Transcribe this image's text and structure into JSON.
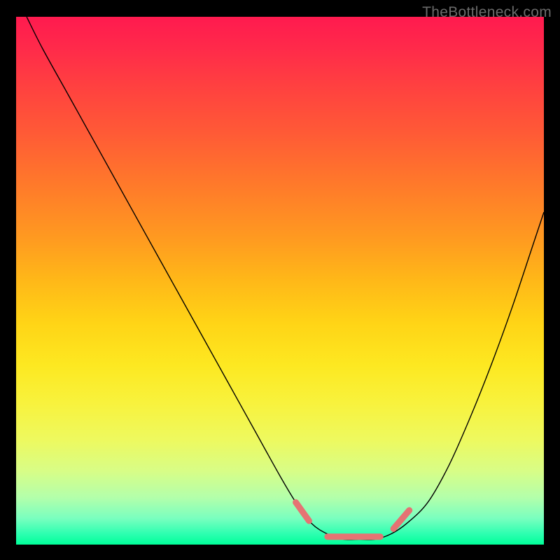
{
  "watermark": "TheBottleneck.com",
  "colors": {
    "background": "#000000",
    "gradient_top": "#ff1a4f",
    "gradient_bottom": "#00ff99",
    "curve": "#000000",
    "marker": "#e57373"
  },
  "chart_data": {
    "type": "line",
    "title": "",
    "xlabel": "",
    "ylabel": "",
    "xlim": [
      0,
      100
    ],
    "ylim": [
      0,
      100
    ],
    "series": [
      {
        "name": "bottleneck-curve",
        "x": [
          2,
          5,
          10,
          15,
          20,
          25,
          30,
          35,
          40,
          45,
          50,
          53,
          56,
          59,
          62,
          65,
          68,
          71,
          74,
          78,
          82,
          86,
          90,
          94,
          98,
          100
        ],
        "values": [
          100,
          94,
          85,
          76,
          67,
          58,
          49,
          40,
          31,
          22,
          13,
          8,
          4,
          2,
          1,
          1,
          1,
          2,
          4,
          8,
          15,
          24,
          34,
          45,
          57,
          63
        ]
      }
    ],
    "markers": [
      {
        "name": "left-segment",
        "x": [
          53.0,
          55.5
        ],
        "y": [
          8.0,
          4.5
        ]
      },
      {
        "name": "bottom-segment",
        "x": [
          59.0,
          69.0
        ],
        "y": [
          1.5,
          1.5
        ]
      },
      {
        "name": "right-segment",
        "x": [
          71.5,
          74.5
        ],
        "y": [
          3.0,
          6.5
        ]
      }
    ]
  }
}
